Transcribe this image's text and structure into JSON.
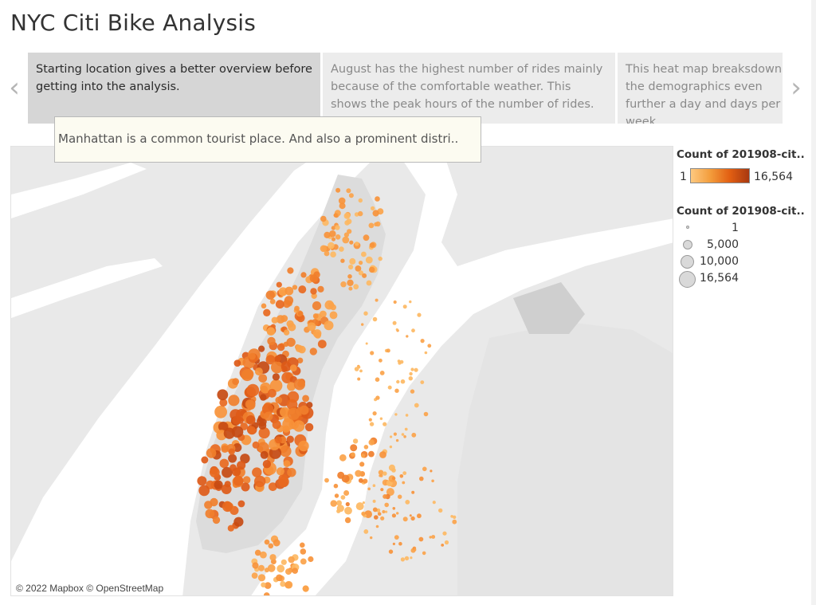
{
  "dashboard": {
    "title": "NYC Citi Bike Analysis"
  },
  "story": {
    "prev_icon": "chevron-left-icon",
    "next_icon": "chevron-right-icon",
    "points": [
      {
        "text": "Starting location gives a better overview before getting into the analysis.",
        "active": true
      },
      {
        "text": "August has the highest number of rides mainly because of the comfortable weather. This shows the peak hours of the number of rides.",
        "active": false
      },
      {
        "text": "This heat map breaksdown the demographics even further a day and days per week.",
        "active": false
      }
    ]
  },
  "tooltip": {
    "text": "Manhattan is a common tourist place. And also a prominent distri.."
  },
  "map": {
    "attribution": "© 2022 Mapbox © OpenStreetMap",
    "water_color": "#ffffff",
    "land_color": "#e9e9e9",
    "manhattan_color": "#dcdcdc"
  },
  "legend": {
    "color_title": "Count of 201908-cit..",
    "color_min": "1",
    "color_max": "16,564",
    "size_title": "Count of 201908-cit..",
    "size_items": [
      "1",
      "5,000",
      "10,000",
      "16,564"
    ]
  }
}
